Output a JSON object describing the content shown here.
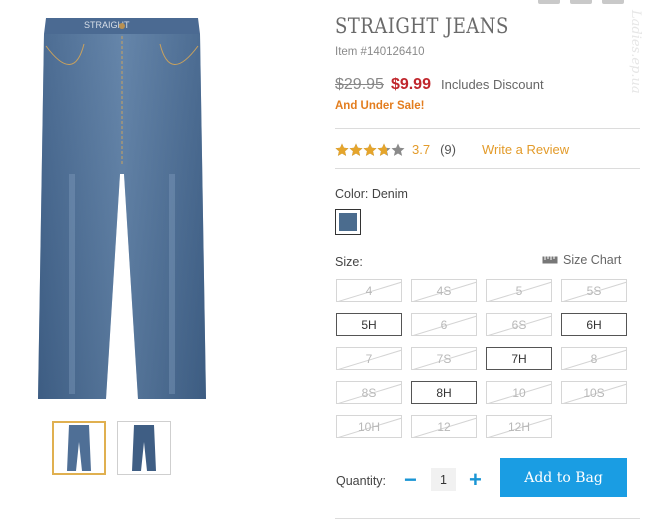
{
  "product": {
    "title": "STRAIGHT JEANS",
    "item_number": "Item #140126410",
    "original_price": "$29.95",
    "sale_price": "$9.99",
    "discount_note": "Includes Discount",
    "sale_note": "And Under Sale!",
    "accent_colors": {
      "sale_price": "#c0262c",
      "highlight": "#e39b2a",
      "button": "#1a9de3"
    }
  },
  "rating": {
    "value": "3.7",
    "count": "(9)",
    "stars_fraction": 0.74,
    "write_review": "Write a Review"
  },
  "color": {
    "label": "Color: Denim",
    "swatch_hex": "#4b6c8e"
  },
  "size": {
    "label": "Size:",
    "chart_link": "Size Chart",
    "options": [
      {
        "label": "4",
        "available": false
      },
      {
        "label": "4S",
        "available": false
      },
      {
        "label": "5",
        "available": false
      },
      {
        "label": "5S",
        "available": false
      },
      {
        "label": "5H",
        "available": true
      },
      {
        "label": "6",
        "available": false
      },
      {
        "label": "6S",
        "available": false
      },
      {
        "label": "6H",
        "available": true
      },
      {
        "label": "7",
        "available": false
      },
      {
        "label": "7S",
        "available": false
      },
      {
        "label": "7H",
        "available": true
      },
      {
        "label": "8",
        "available": false
      },
      {
        "label": "8S",
        "available": false
      },
      {
        "label": "8H",
        "available": true
      },
      {
        "label": "10",
        "available": false
      },
      {
        "label": "10S",
        "available": false
      },
      {
        "label": "10H",
        "available": false
      },
      {
        "label": "12",
        "available": false
      },
      {
        "label": "12H",
        "available": false
      }
    ]
  },
  "quantity": {
    "label": "Quantity:",
    "minus": "−",
    "value": "1",
    "plus": "+"
  },
  "cart": {
    "button_label": "Add to Bag"
  },
  "icons": {
    "main_image": "jeans-image",
    "size_chart": "ruler-icon",
    "rating": "star-icon"
  },
  "watermark": "Ladies.ep.ua"
}
